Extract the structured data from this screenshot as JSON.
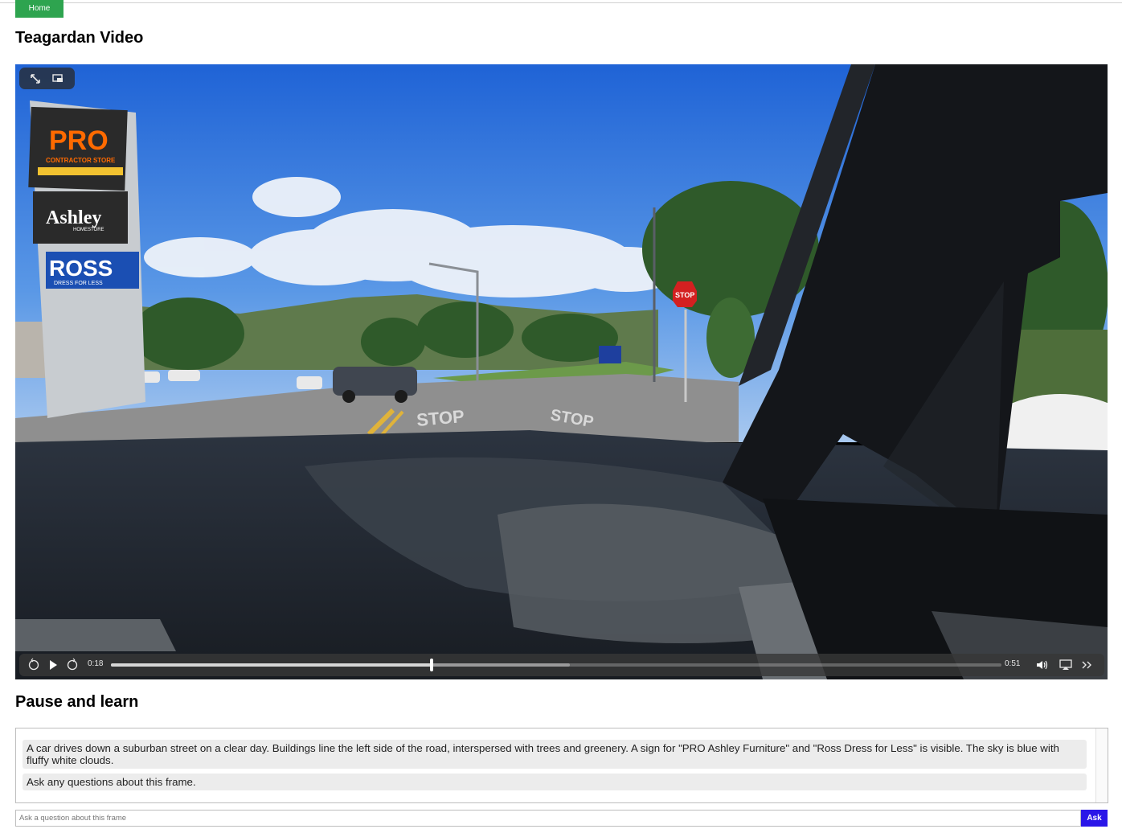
{
  "nav": {
    "home_label": "Home"
  },
  "page": {
    "title": "Teagardan Video"
  },
  "video": {
    "current_time": "0:18",
    "duration": "0:51",
    "progress": 0.36,
    "buffered": 0.515,
    "scene_signs": {
      "pro": "PRO",
      "pro_sub": "CONTRACTOR STORE",
      "ashley": "Ashley",
      "ashley_sub": "HOMESTORE",
      "ross": "ROSS",
      "ross_sub": "DRESS FOR LESS",
      "stop_sign": "STOP",
      "road_marking_1": "STOP",
      "road_marking_2": "STOP"
    }
  },
  "learn": {
    "title": "Pause and learn",
    "messages": [
      "A car drives down a suburban street on a clear day. Buildings line the left side of the road, interspersed with trees and greenery. A sign for \"PRO Ashley Furniture\" and \"Ross Dress for Less\" is visible. The sky is blue with fluffy white clouds.",
      "Ask any questions about this frame."
    ],
    "input_placeholder": "Ask a question about this frame",
    "ask_label": "Ask"
  }
}
